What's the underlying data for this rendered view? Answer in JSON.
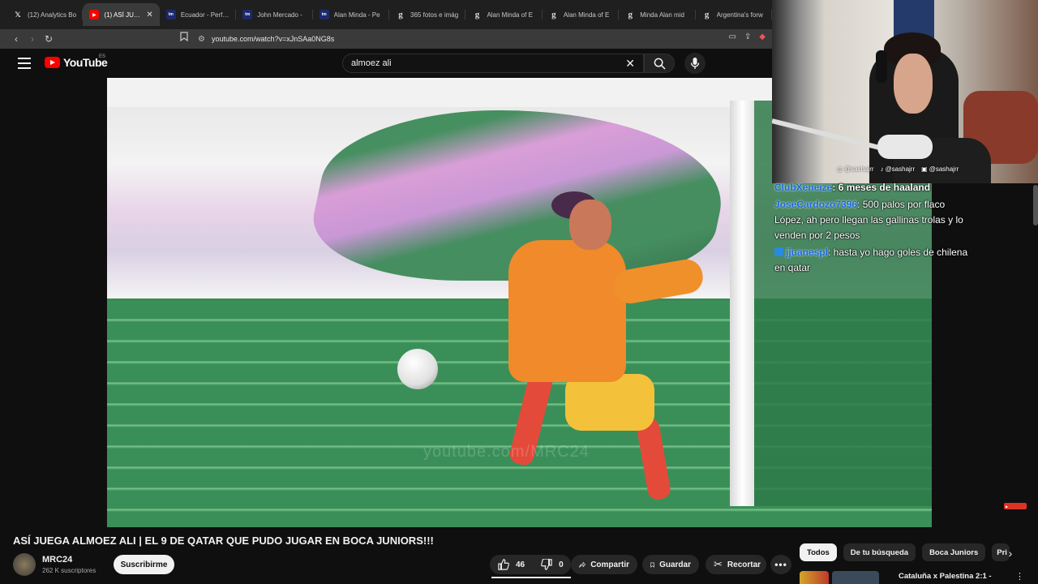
{
  "browser": {
    "tabs": [
      {
        "label": "(12) Analytics Bo",
        "icon": "x-icon"
      },
      {
        "label": "(1) ASÍ JUEG",
        "icon": "youtube-icon",
        "active": true
      },
      {
        "label": "Ecuador - Perfil d",
        "icon": "transfermarkt-icon"
      },
      {
        "label": "John Mercado -",
        "icon": "transfermarkt-icon"
      },
      {
        "label": "Alan Minda - Pe",
        "icon": "transfermarkt-icon"
      },
      {
        "label": "365 fotos e imág",
        "icon": "getty-icon"
      },
      {
        "label": "Alan Minda of E",
        "icon": "getty-icon"
      },
      {
        "label": "Alan Minda of E",
        "icon": "getty-icon"
      },
      {
        "label": "Minda Alan mid",
        "icon": "getty-icon"
      },
      {
        "label": "Argentina's forw",
        "icon": "getty-icon"
      }
    ],
    "url": "youtube.com/watch?v=xJnSAa0NG8s"
  },
  "youtube": {
    "logo_text": "YouTube",
    "country_code": "ES",
    "search_query": "almoez ali",
    "video": {
      "watermark": "youtube.com/MRC24",
      "title": "ASÍ JUEGA ALMOEZ ALI | EL 9 DE QATAR QUE PUDO JUGAR EN BOCA JUNIORS!!!",
      "channel": "MRC24",
      "subscribers": "262 K suscriptores",
      "subscribe_label": "Suscribirme",
      "likes": "46",
      "dislikes": "0",
      "share_label": "Compartir",
      "save_label": "Guardar",
      "clip_label": "Recortar"
    },
    "chips": [
      "Todos",
      "De tu búsqueda",
      "Boca Juniors",
      "Pri"
    ],
    "recommended": {
      "title": "Cataluña x Palestina 2:1 -"
    }
  },
  "stream": {
    "socials": [
      {
        "icon": "instagram-icon",
        "handle": "@sashajrr"
      },
      {
        "icon": "tiktok-icon",
        "handle": "@sashajrr"
      },
      {
        "icon": "twitch-icon",
        "handle": "@sashajrr"
      }
    ],
    "chat": [
      {
        "user": "ClubXeneize",
        "text": ": 6 meses de haaland"
      },
      {
        "user": "JoseCardozo7396",
        "text": ": 500 palos por flaco López, ah pero llegan las gallinas trolas y lo venden por 2 pesos"
      },
      {
        "user": "jjuanespl",
        "text": ": hasta yo hago goles de chilena en qatar"
      }
    ]
  },
  "colors": {
    "youtube_red": "#ff0000",
    "background": "#0f0f0f",
    "chat_username": "#1a6adf"
  }
}
